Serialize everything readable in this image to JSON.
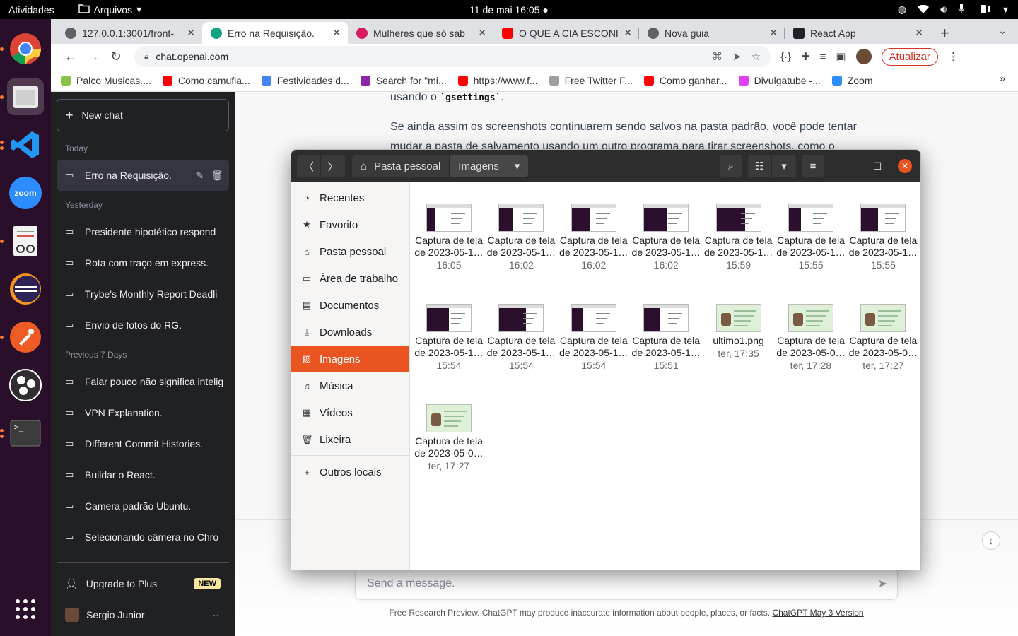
{
  "topbar": {
    "activities": "Atividades",
    "app_name": "Arquivos",
    "clock": "11 de mai  16:05"
  },
  "tabs": [
    {
      "title": "127.0.0.1:3001/front-",
      "fav_color": "#5f6368"
    },
    {
      "title": "Erro na Requisição.",
      "fav_color": "#10a37f"
    },
    {
      "title": "Mulheres que só sab",
      "fav_color": "#d81b60"
    },
    {
      "title": "O QUE A CIA ESCONI",
      "fav_color": "#ff0000"
    },
    {
      "title": "Nova guia",
      "fav_color": "#5f6368"
    },
    {
      "title": "React App",
      "fav_color": "#20232a"
    }
  ],
  "toolbar": {
    "url": "chat.openai.com",
    "update_label": "Atualizar"
  },
  "bookmarks": [
    {
      "label": "Palco Musicas....",
      "color": "#8bc34a"
    },
    {
      "label": "Como camufla...",
      "color": "#ff0000"
    },
    {
      "label": "Festividades d...",
      "color": "#4285f4"
    },
    {
      "label": "Search for \"mi...",
      "color": "#8e24aa"
    },
    {
      "label": "https://www.f...",
      "color": "#ff0000"
    },
    {
      "label": "Free Twitter F...",
      "color": "#9e9e9e"
    },
    {
      "label": "Como ganhar...",
      "color": "#ff0000"
    },
    {
      "label": "Divulgatube -...",
      "color": "#e040fb"
    },
    {
      "label": "Zoom",
      "color": "#2d8cff"
    }
  ],
  "sidebar": {
    "new_chat": "New chat",
    "group_today": "Today",
    "group_yesterday": "Yesterday",
    "group_prev7": "Previous 7 Days",
    "today": [
      "Erro na Requisição."
    ],
    "yesterday": [
      "Presidente hipotético respond",
      "Rota com traço em express.",
      "Trybe's Monthly Report Deadli",
      "Envio de fotos do RG."
    ],
    "prev7": [
      "Falar pouco não significa intelig",
      "VPN Explanation.",
      "Different Commit Histories.",
      "Buildar o React.",
      "Camera padrão Ubuntu.",
      "Selecionando câmera no Chro"
    ],
    "upgrade": "Upgrade to Plus",
    "new_badge": "NEW",
    "user": "Sergio Junior"
  },
  "chat": {
    "line_top_pre": "usando o ",
    "line_top_code": "`gsettings`",
    "line_top_post": ".",
    "para1": "Se ainda assim os screenshots continuarem sendo salvos na pasta padrão, você pode tentar mudar a pasta de salvamento usando um outro programa para tirar screenshots, como o",
    "placeholder": "Send a message.",
    "disclaimer": "Free Research Preview. ChatGPT may produce inaccurate information about people, places, or facts.",
    "version_link": "ChatGPT May 3 Version"
  },
  "files": {
    "path_home": "Pasta pessoal",
    "path_current": "Imagens",
    "places": [
      {
        "label": "Recentes",
        "icon": "clock-icon"
      },
      {
        "label": "Favorito",
        "icon": "star-icon"
      },
      {
        "label": "Pasta pessoal",
        "icon": "home-icon"
      },
      {
        "label": "Área de trabalho",
        "icon": "desktop-icon"
      },
      {
        "label": "Documentos",
        "icon": "document-icon"
      },
      {
        "label": "Downloads",
        "icon": "download-icon"
      },
      {
        "label": "Imagens",
        "icon": "image-icon"
      },
      {
        "label": "Música",
        "icon": "music-icon"
      },
      {
        "label": "Vídeos",
        "icon": "video-icon"
      },
      {
        "label": "Lixeira",
        "icon": "trash-icon"
      }
    ],
    "other_places": "Outros locais",
    "items": [
      {
        "name": "Captura de tela de 2023-05-1…",
        "date": "16:05",
        "kind": "shot"
      },
      {
        "name": "Captura de tela de 2023-05-1…",
        "date": "16:02",
        "kind": "shot"
      },
      {
        "name": "Captura de tela de 2023-05-1…",
        "date": "16:02",
        "kind": "shot"
      },
      {
        "name": "Captura de tela de 2023-05-1…",
        "date": "16:02",
        "kind": "shot"
      },
      {
        "name": "Captura de tela de 2023-05-1…",
        "date": "15:59",
        "kind": "shot"
      },
      {
        "name": "Captura de tela de 2023-05-1…",
        "date": "15:55",
        "kind": "shot"
      },
      {
        "name": "Captura de tela de 2023-05-1…",
        "date": "15:55",
        "kind": "shot"
      },
      {
        "name": "Captura de tela de 2023-05-1…",
        "date": "15:54",
        "kind": "shot"
      },
      {
        "name": "Captura de tela de 2023-05-1…",
        "date": "15:54",
        "kind": "shot"
      },
      {
        "name": "Captura de tela de 2023-05-1…",
        "date": "15:54",
        "kind": "shot"
      },
      {
        "name": "Captura de tela de 2023-05-1…",
        "date": "15:51",
        "kind": "shot"
      },
      {
        "name": "ultimo1.png",
        "date": "ter, 17:35",
        "kind": "doc"
      },
      {
        "name": "Captura de tela de 2023-05-0…",
        "date": "ter, 17:28",
        "kind": "doc"
      },
      {
        "name": "Captura de tela de 2023-05-0…",
        "date": "ter, 17:27",
        "kind": "doc"
      },
      {
        "name": "Captura de tela de 2023-05-0…",
        "date": "ter, 17:27",
        "kind": "doc"
      }
    ]
  },
  "colors": {
    "ubuntu_orange": "#e95420",
    "chat_sidebar": "#202123"
  }
}
